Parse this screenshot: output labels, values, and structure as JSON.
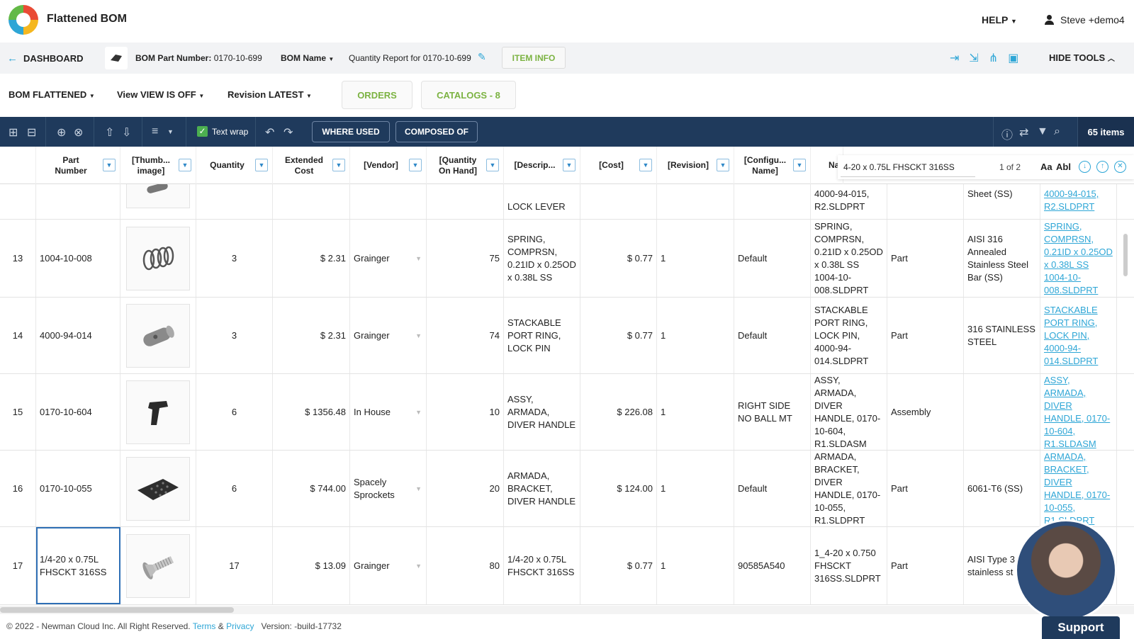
{
  "app": {
    "title": "Flattened BOM",
    "help": "HELP",
    "user": "Steve +demo4"
  },
  "nav": {
    "dashboard": "DASHBOARD",
    "part_number_label": "BOM Part Number:",
    "part_number": "0170-10-699",
    "bom_name_label": "BOM Name",
    "report_title": "Quantity Report for 0170-10-699",
    "item_info": "ITEM INFO",
    "hide_tools": "HIDE TOOLS"
  },
  "options": {
    "bom_label": "BOM",
    "bom_value": "FLATTENED",
    "view_label": "View",
    "view_value": "VIEW IS OFF",
    "revision_label": "Revision",
    "revision_value": "LATEST",
    "orders": "ORDERS",
    "catalogs": "CATALOGS - 8"
  },
  "toolbar": {
    "text_wrap": "Text wrap",
    "where_used": "WHERE USED",
    "composed_of": "COMPOSED OF",
    "items_count": "65 items"
  },
  "columns": [
    "Part Number",
    "[Thumb... image]",
    "Quantity",
    "Extended Cost",
    "[Vendor]",
    "[Quantity On Hand]",
    "[Descrip...",
    "[Cost]",
    "[Revision]",
    "[Configu... Name]",
    "Na"
  ],
  "find": {
    "value": "4-20 x 0.75L FHSCKT 316SS",
    "count": "1 of 2",
    "match_case": "Aa",
    "whole_word": "Abl"
  },
  "partial_row": {
    "desc": "LOCK LEVER",
    "name": "4000-94-015, R2.SLDPRT",
    "material": "Sheet (SS)",
    "link": "4000-94-015, R2.SLDPRT"
  },
  "rows": [
    {
      "num": "13",
      "part": "1004-10-008",
      "qty": "3",
      "ext": "$ 2.31",
      "vendor": "Grainger",
      "onhand": "75",
      "desc": "SPRING, COMPRSN, 0.21ID x 0.25OD x 0.38L SS",
      "cost": "$ 0.77",
      "rev": "1",
      "config": "Default",
      "name": "SPRING, COMPRSN, 0.21ID x 0.25OD x 0.38L SS 1004-10-008.SLDPRT",
      "type": "Part",
      "material": "AISI 316 Annealed Stainless Steel Bar (SS)",
      "link": "SPRING, COMPRSN, 0.21ID x 0.25OD x 0.38L SS 1004-10-008.SLDPRT",
      "thumb": "spring-thumbnail"
    },
    {
      "num": "14",
      "part": "4000-94-014",
      "qty": "3",
      "ext": "$ 2.31",
      "vendor": "Grainger",
      "onhand": "74",
      "desc": "STACKABLE PORT RING, LOCK PIN",
      "cost": "$ 0.77",
      "rev": "1",
      "config": "Default",
      "name": "STACKABLE PORT RING, LOCK PIN, 4000-94-014.SLDPRT",
      "type": "Part",
      "material": "316 STAINLESS STEEL",
      "link": "STACKABLE PORT RING, LOCK PIN, 4000-94-014.SLDPRT",
      "thumb": "pin-thumbnail"
    },
    {
      "num": "15",
      "part": "0170-10-604",
      "qty": "6",
      "ext": "$ 1356.48",
      "vendor": "In House",
      "onhand": "10",
      "desc": "ASSY, ARMADA, DIVER HANDLE",
      "cost": "$ 226.08",
      "rev": "1",
      "config": "RIGHT SIDE NO BALL MT",
      "name": "ASSY, ARMADA, DIVER HANDLE, 0170-10-604, R1.SLDASM",
      "type": "Assembly",
      "material": "",
      "link": "ASSY, ARMADA, DIVER HANDLE, 0170-10-604, R1.SLDASM",
      "thumb": "handle-thumbnail"
    },
    {
      "num": "16",
      "part": "0170-10-055",
      "qty": "6",
      "ext": "$ 744.00",
      "vendor": "Spacely Sprockets",
      "onhand": "20",
      "desc": "ARMADA, BRACKET, DIVER HANDLE",
      "cost": "$ 124.00",
      "rev": "1",
      "config": "Default",
      "name": "ARMADA, BRACKET, DIVER HANDLE, 0170-10-055, R1.SLDPRT",
      "type": "Part",
      "material": "6061-T6 (SS)",
      "link": "ARMADA, BRACKET, DIVER HANDLE, 0170-10-055, R1.SLDPRT",
      "thumb": "bracket-thumbnail"
    },
    {
      "num": "17",
      "part": "1/4-20 x 0.75L FHSCKT 316SS",
      "qty": "17",
      "ext": "$ 13.09",
      "vendor": "Grainger",
      "onhand": "80",
      "desc": "1/4-20 x 0.75L FHSCKT 316SS",
      "cost": "$ 0.77",
      "rev": "1",
      "config": "90585A540",
      "name": "1_4-20 x 0.750 FHSCKT 316SS.SLDPRT",
      "type": "Part",
      "material": "AISI Type 3 stainless st",
      "link": "",
      "thumb": "screw-thumbnail"
    }
  ],
  "footer": {
    "copyright": "© 2022 - Newman Cloud Inc. All Right Reserved.",
    "terms": "Terms",
    "amp": "&",
    "privacy": "Privacy",
    "version": "Version: -build-17732"
  },
  "support": "Support"
}
